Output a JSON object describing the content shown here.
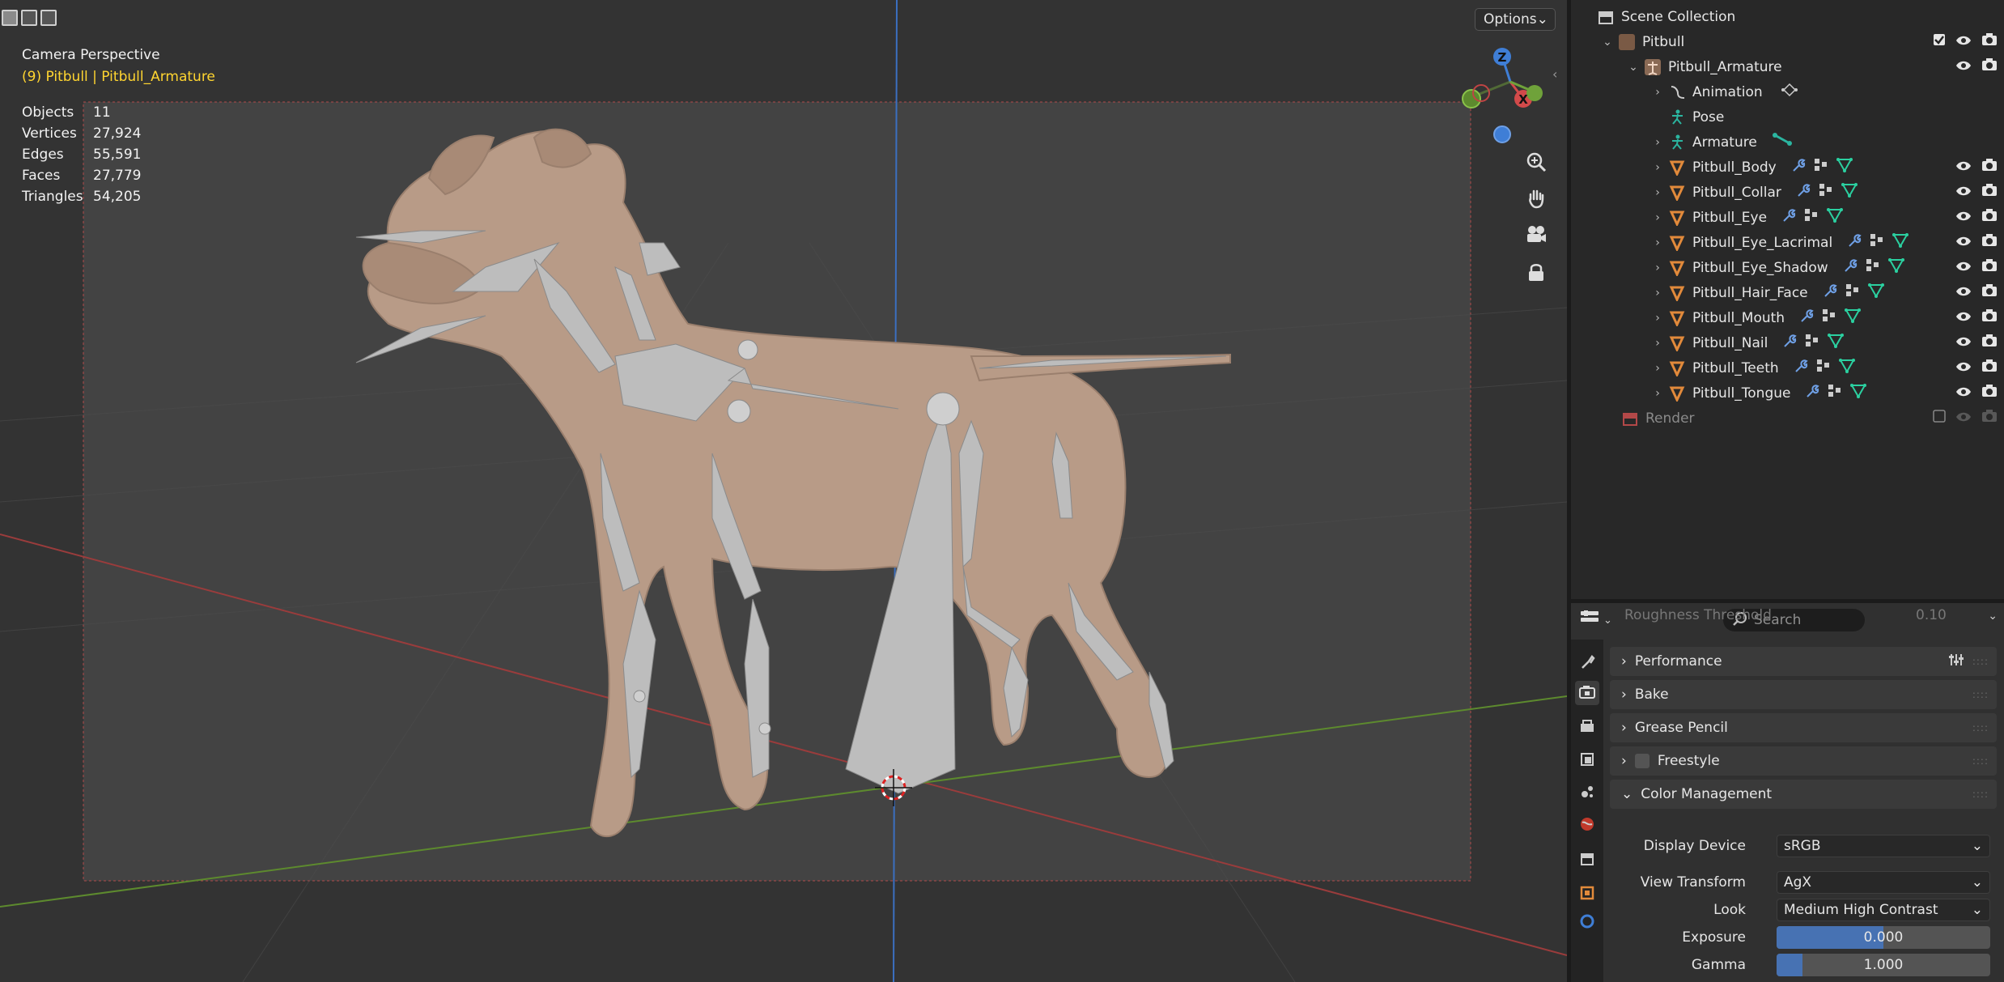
{
  "viewport": {
    "options_label": "Options",
    "camera_title": "Camera Perspective",
    "camera_subtitle": "(9) Pitbull | Pitbull_Armature",
    "stats": [
      {
        "label": "Objects",
        "value": "11"
      },
      {
        "label": "Vertices",
        "value": "27,924"
      },
      {
        "label": "Edges",
        "value": "55,591"
      },
      {
        "label": "Faces",
        "value": "27,779"
      },
      {
        "label": "Triangles",
        "value": "54,205"
      }
    ],
    "gizmo": {
      "z": "Z",
      "x": "X"
    },
    "nav_icons": [
      "zoom-icon",
      "hand-pan-icon",
      "camera-view-icon",
      "lock-icon"
    ]
  },
  "outliner": {
    "scene_collection": "Scene Collection",
    "pitbull": "Pitbull",
    "armature": "Pitbull_Armature",
    "animation": "Animation",
    "pose": "Pose",
    "armature_data": "Armature",
    "meshes": [
      {
        "name": "Pitbull_Body"
      },
      {
        "name": "Pitbull_Collar"
      },
      {
        "name": "Pitbull_Eye"
      },
      {
        "name": "Pitbull_Eye_Lacrimal"
      },
      {
        "name": "Pitbull_Eye_Shadow"
      },
      {
        "name": "Pitbull_Hair_Face"
      },
      {
        "name": "Pitbull_Mouth"
      },
      {
        "name": "Pitbull_Nail"
      },
      {
        "name": "Pitbull_Teeth"
      },
      {
        "name": "Pitbull_Tongue"
      }
    ],
    "render": "Render"
  },
  "properties": {
    "search_placeholder": "Search",
    "cutoff_label": "Roughness Threshold",
    "cutoff_value": "0.10",
    "panels": {
      "performance": "Performance",
      "bake": "Bake",
      "grease_pencil": "Grease Pencil",
      "freestyle": "Freestyle",
      "color_management": "Color Management"
    },
    "display_device_label": "Display Device",
    "display_device_value": "sRGB",
    "view_transform_label": "View Transform",
    "view_transform_value": "AgX",
    "look_label": "Look",
    "look_value": "Medium High Contrast",
    "exposure_label": "Exposure",
    "exposure_value": "0.000",
    "exposure_fill": 0.5,
    "gamma_label": "Gamma",
    "gamma_value": "1.000",
    "gamma_fill": 0.12
  },
  "colors": {
    "viewport_bg": "#3d3d3d",
    "accent_blue": "#4772b3",
    "selected_yellow": "#ffd530",
    "mesh_orange": "#e28a3b",
    "axis_red": "#d24a4a",
    "axis_green": "#6fa23a",
    "axis_blue": "#3f7ed6"
  }
}
